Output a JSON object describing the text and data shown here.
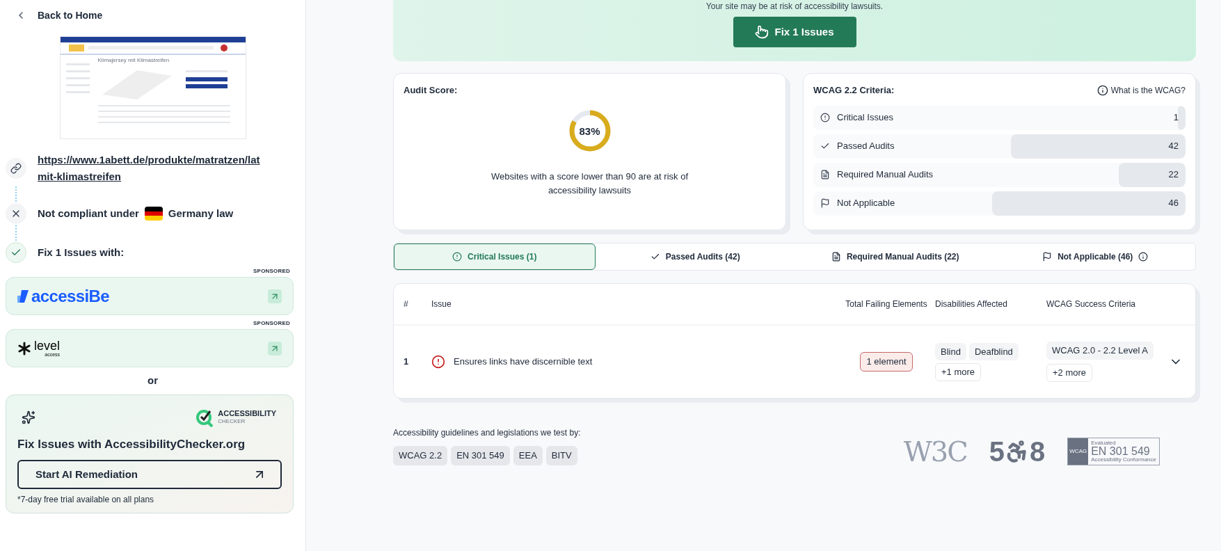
{
  "sidebar": {
    "back_link": "Back to Home",
    "thumbnail": {
      "title": "Klimajersey mit Klimastreifen"
    },
    "url_lines": [
      "https://www.1abett.de/produkte/matratzen/lat",
      "mit-klimastreifen"
    ],
    "steps": [
      {
        "kind": "fail",
        "text_before": "Not compliant under",
        "text_after": "Germany law"
      },
      {
        "kind": "done",
        "text": "Fix 1 Issues with:"
      }
    ],
    "sponsors": [
      {
        "kind": "accessibe",
        "label": "SPONSORED",
        "name": "accessiBe"
      },
      {
        "kind": "level",
        "label": "SPONSORED",
        "name": "level",
        "sub": "access"
      }
    ],
    "separator": "or",
    "promo": {
      "brand": "ACCESSIBILITY",
      "brand_sub": "CHECKER",
      "title": "Fix Issues with AccessibilityChecker.org",
      "button": "Start AI Remediation",
      "note": "*7-day free trial available on all plans"
    }
  },
  "banner": {
    "message": "Your site may be at risk of accessibility lawsuits.",
    "button": "Fix 1 Issues"
  },
  "audit": {
    "title": "Audit Score:",
    "score": "83%",
    "level": 0.83,
    "note": "Websites with a score lower than 90 are at risk of accessibility lawsuits"
  },
  "wcag": {
    "title": "WCAG 2.2 Criteria:",
    "help_link": "What is the WCAG?",
    "rows": [
      {
        "kind": "critical",
        "label": "Critical Issues",
        "count": "1",
        "level": 0.02
      },
      {
        "kind": "passed",
        "label": "Passed Audits",
        "count": "42",
        "level": 0.47
      },
      {
        "kind": "manual",
        "label": "Required Manual Audits",
        "count": "22",
        "level": 0.18
      },
      {
        "kind": "na",
        "label": "Not Applicable",
        "count": "46",
        "level": 0.52
      }
    ]
  },
  "tabs": [
    {
      "kind": "critical",
      "label": "Critical Issues (1)",
      "selected": true,
      "info": false
    },
    {
      "kind": "passed",
      "label": "Passed Audits (42)",
      "selected": false,
      "info": false
    },
    {
      "kind": "manual",
      "label": "Required Manual Audits (22)",
      "selected": false,
      "info": false
    },
    {
      "kind": "na",
      "label": "Not Applicable (46)",
      "selected": false,
      "info": true
    }
  ],
  "table": {
    "columns": [
      "#",
      "Issue",
      "Total Failing Elements",
      "Disabilities Affected",
      "WCAG Success Criteria"
    ],
    "rows": [
      {
        "number": "1",
        "issue": "Ensures links have discernible text",
        "failing": "1 element",
        "disabilities": [
          "Blind",
          "Deafblind"
        ],
        "disabilities_more": "+1 more",
        "criteria": [
          "WCAG 2.0 - 2.2 Level A"
        ],
        "criteria_more": "+2 more",
        "expanded": false
      }
    ]
  },
  "footer": {
    "heading": "Accessibility guidelines and legislations we test by:",
    "standards": [
      "WCAG 2.2",
      "EN 301 549",
      "EEA",
      "BITV"
    ],
    "w3c": "W3C",
    "section508": {
      "before": "5",
      "after": "8"
    },
    "en_badge": {
      "side": "WCAG",
      "top": "Evaluated",
      "main": "EN 301 549",
      "bottom": "Accessibility Conformance"
    }
  }
}
